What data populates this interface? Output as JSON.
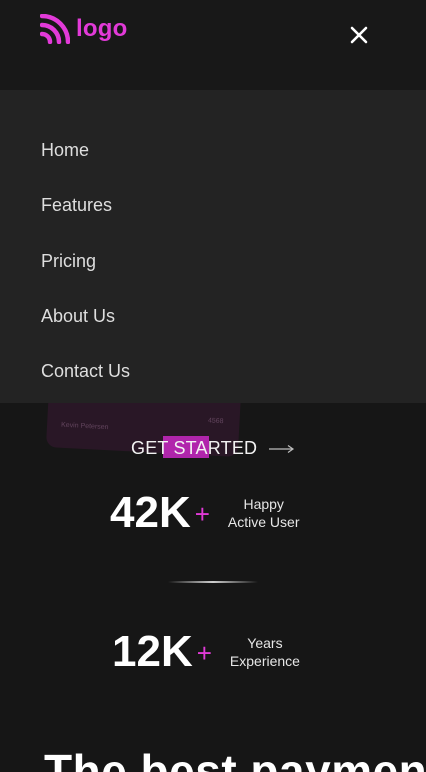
{
  "header": {
    "logo_text": "logo",
    "logo_icon": "rss-feed-icon",
    "close_icon": "close-icon",
    "accent_color": "#e23ad8"
  },
  "menu": {
    "items": [
      {
        "label": "Home"
      },
      {
        "label": "Features"
      },
      {
        "label": "Pricing"
      },
      {
        "label": "About Us"
      },
      {
        "label": "Contact Us"
      }
    ]
  },
  "card": {
    "holder": "Kevin Petersen",
    "number": "4568"
  },
  "hero": {
    "cta_label": "GET STARTED",
    "cta_icon": "long-arrow-right-icon"
  },
  "stats": [
    {
      "value": "42K",
      "plus": "+",
      "label_line1": "Happy",
      "label_line2": "Active User"
    },
    {
      "value": "12K",
      "plus": "+",
      "label_line1": "Years",
      "label_line2": "Experience"
    }
  ],
  "section": {
    "headline": "The best payment"
  }
}
